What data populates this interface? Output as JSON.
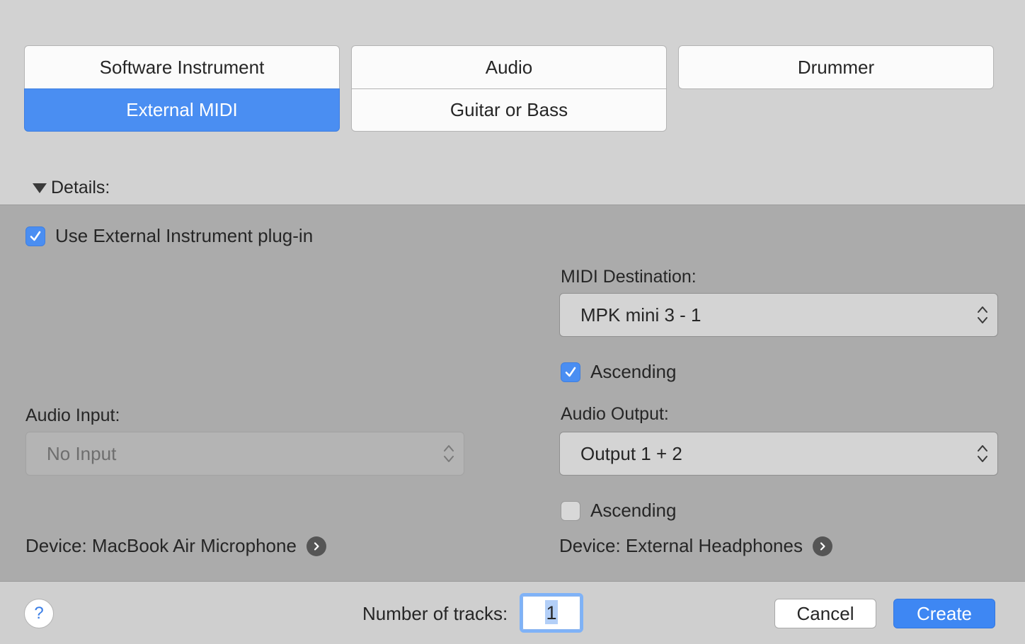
{
  "track_types": {
    "software_instrument": "Software Instrument",
    "audio": "Audio",
    "drummer": "Drummer",
    "external_midi": "External MIDI",
    "guitar_or_bass": "Guitar or Bass",
    "selected": "External MIDI"
  },
  "details": {
    "toggle_label": "Details:",
    "use_external_plugin": {
      "label": "Use External Instrument plug-in",
      "checked": true
    },
    "midi_destination": {
      "label": "MIDI Destination:",
      "value": "MPK mini 3 - 1",
      "ascending": {
        "label": "Ascending",
        "checked": true
      }
    },
    "audio_input": {
      "label": "Audio Input:",
      "value": "No Input",
      "enabled": false,
      "device": "Device: MacBook Air Microphone"
    },
    "audio_output": {
      "label": "Audio Output:",
      "value": "Output 1 + 2",
      "ascending": {
        "label": "Ascending",
        "checked": false
      },
      "device": "Device: External Headphones"
    }
  },
  "footer": {
    "help": "?",
    "tracks_label": "Number of tracks:",
    "tracks_value": "1",
    "cancel": "Cancel",
    "create": "Create"
  },
  "colors": {
    "accent": "#4a8ef2",
    "pane_top": "#d2d2d2",
    "pane_details": "#ababab"
  },
  "icons": [
    "disclosure-triangle-icon",
    "checkmark-icon",
    "up-down-chevron-icon",
    "arrow-right-circle-icon"
  ]
}
